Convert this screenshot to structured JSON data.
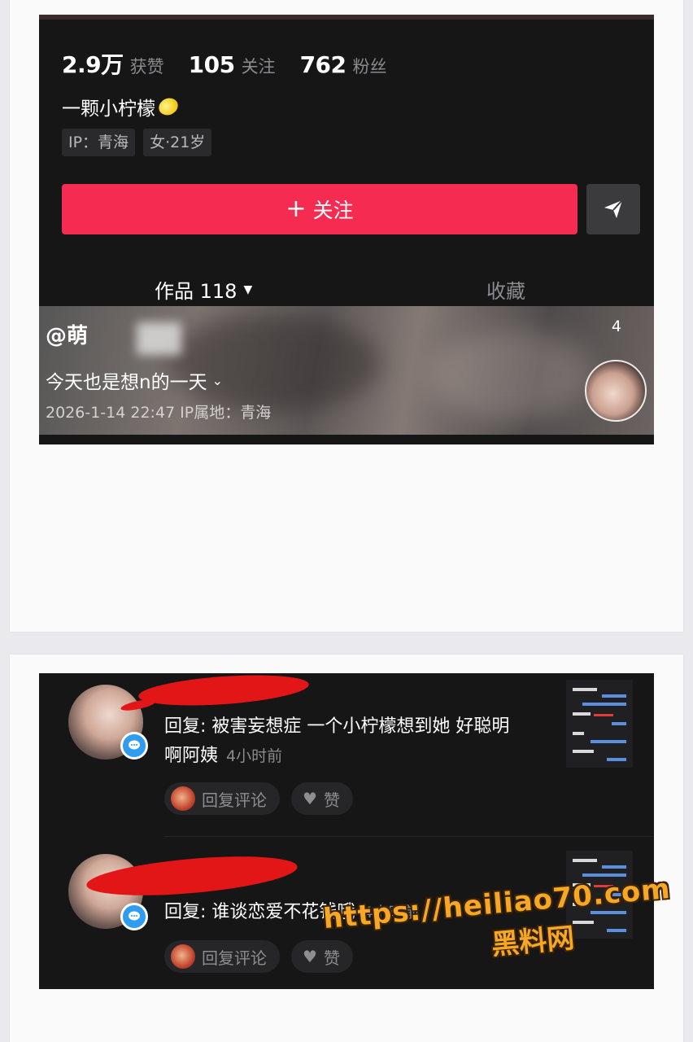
{
  "profile": {
    "stats": [
      {
        "num": "2.9万",
        "label": "获赞"
      },
      {
        "num": "105",
        "label": "关注"
      },
      {
        "num": "762",
        "label": "粉丝"
      }
    ],
    "bio": "一颗小柠檬",
    "tags": [
      "IP：青海",
      "女·21岁"
    ],
    "follow_label": "关注",
    "follow_plus": "+",
    "tabs": {
      "works": "作品 118",
      "favorites": "收藏"
    }
  },
  "post": {
    "author": "@萌",
    "count": "4",
    "caption": "今天也是想n的一天",
    "meta": "2026-1-14 22:47  IP属地：青海"
  },
  "comments": [
    {
      "text": "回复: 被害妄想症 一个小柠檬想到她 好聪明啊阿姨",
      "time": "4小时前",
      "reply_label": "回复评论",
      "like_label": "赞"
    },
    {
      "text": "回复: 谁谈恋爱不花钱哦",
      "time": "4小时前",
      "reply_label": "回复评论",
      "like_label": "赞"
    }
  ],
  "watermark": {
    "url": "https://heiliao70.com",
    "name": "黑料网"
  },
  "colors": {
    "accent": "#f52b52",
    "badge": "#2f9cf2",
    "watermark": "#f6a724"
  },
  "icons": [
    "lemon-icon",
    "plus-icon",
    "share-icon",
    "caret-down-icon",
    "chevron-down-icon",
    "message-badge-icon",
    "heart-icon"
  ]
}
